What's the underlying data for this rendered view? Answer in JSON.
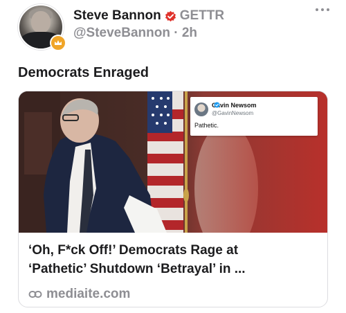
{
  "post": {
    "author": {
      "display_name": "Steve Bannon",
      "platform": "GETTR",
      "handle": "@SteveBannon",
      "separator": "·",
      "time_ago": "2h",
      "avatar_icon": "portrait-avatar",
      "badge_icon": "influencer-badge-icon",
      "badge_color": "#f0a528",
      "verified_icon": "verified-badge-icon",
      "verified_color": "#e0322b"
    },
    "text": "Democrats Enraged",
    "link_card": {
      "image_icon": "news-photo",
      "embedded_tweet": {
        "name": "Gavin Newsom",
        "handle": "@GavinNewsom",
        "text": "Pathetic.",
        "verified_color": "#1d9bf0"
      },
      "title_line1": "‘Oh, F*ck Off!’ Democrats Rage at",
      "title_line2": "‘Pathetic’ Shutdown ‘Betrayal’ in ...",
      "domain": "mediaite.com",
      "link_icon": "link-icon"
    }
  },
  "more_icon": "more-horizontal-icon"
}
